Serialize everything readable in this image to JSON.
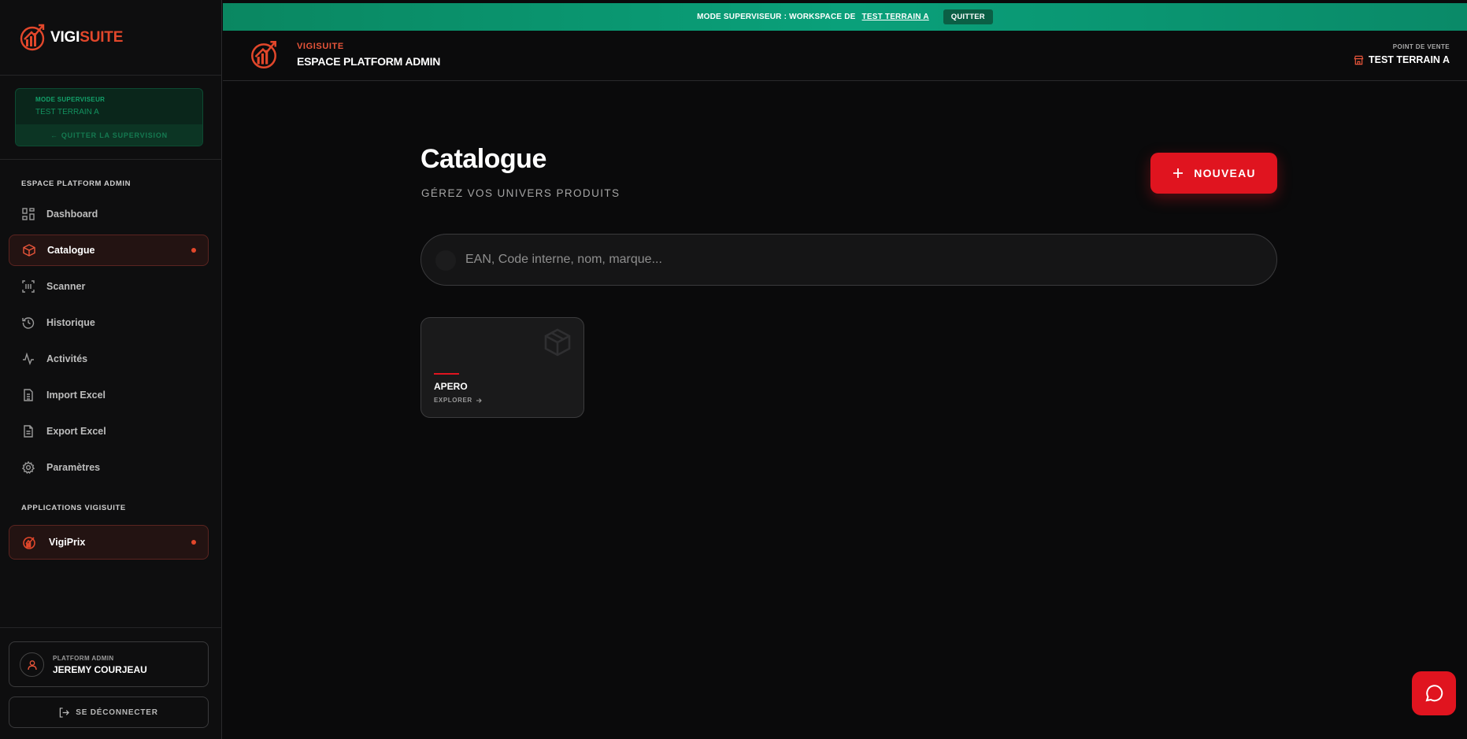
{
  "sidebar": {
    "logo": {
      "part1": "VIGI",
      "part2": "SUITE"
    },
    "supervisor": {
      "label": "MODE SUPERVISEUR",
      "workspace": "TEST TERRAIN A",
      "quit": "QUITTER LA SUPERVISION",
      "quit_arrow": "←"
    },
    "section_admin": "ESPACE PLATFORM ADMIN",
    "nav": [
      {
        "label": "Dashboard",
        "icon": "grid-icon",
        "active": false
      },
      {
        "label": "Catalogue",
        "icon": "box-icon",
        "active": true
      },
      {
        "label": "Scanner",
        "icon": "scan-icon",
        "active": false
      },
      {
        "label": "Historique",
        "icon": "history-icon",
        "active": false
      },
      {
        "label": "Activités",
        "icon": "activity-icon",
        "active": false
      },
      {
        "label": "Import Excel",
        "icon": "spreadsheet-icon",
        "active": false
      },
      {
        "label": "Export Excel",
        "icon": "document-icon",
        "active": false
      },
      {
        "label": "Paramètres",
        "icon": "gear-icon",
        "active": false
      }
    ],
    "section_apps": "APPLICATIONS VIGISUITE",
    "apps": [
      {
        "label": "VigiPrix",
        "icon": "vigiprix-logo-icon",
        "active": true
      }
    ],
    "user": {
      "role": "PLATFORM ADMIN",
      "name": "JEREMY COURJEAU"
    },
    "logout": "SE DÉCONNECTER"
  },
  "banner": {
    "text": "MODE SUPERVISEUR : WORKSPACE DE",
    "workspace": "TEST TERRAIN A",
    "quit": "QUITTER"
  },
  "header": {
    "brand": "VIGISUITE",
    "space": "ESPACE PLATFORM ADMIN",
    "pos_label": "POINT DE VENTE",
    "pos_value": "TEST TERRAIN A"
  },
  "main": {
    "title": "Catalogue",
    "subtitle": "GÉREZ VOS UNIVERS PRODUITS",
    "new_button": "NOUVEAU",
    "search_placeholder": "EAN, Code interne, nom, marque...",
    "cards": [
      {
        "name": "APERO",
        "action": "EXPLORER"
      }
    ]
  },
  "colors": {
    "accent_red": "#e0141f",
    "brand_orange": "#e2472b",
    "supervisor_green": "#0aa07a",
    "background": "#0a0a0b"
  }
}
